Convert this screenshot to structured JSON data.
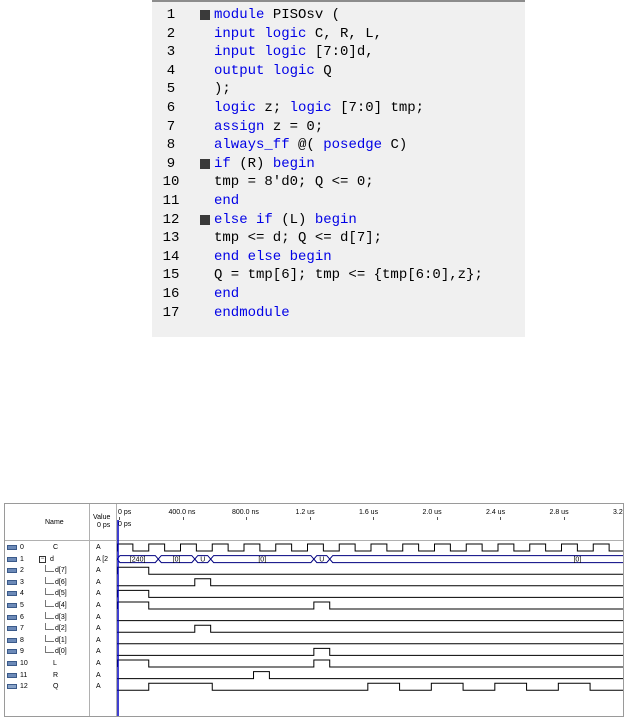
{
  "editor": {
    "lines": [
      {
        "num": "1",
        "fold": true,
        "parts": [
          {
            "t": "module ",
            "kw": true
          },
          {
            "t": "PISOsv (",
            "kw": false
          }
        ]
      },
      {
        "num": "2",
        "fold": false,
        "parts": [
          {
            "t": "input logic ",
            "kw": true
          },
          {
            "t": "C, R, L,",
            "kw": false
          }
        ]
      },
      {
        "num": "3",
        "fold": false,
        "parts": [
          {
            "t": "input logic ",
            "kw": true
          },
          {
            "t": "[7:0]d,",
            "kw": false
          }
        ]
      },
      {
        "num": "4",
        "fold": false,
        "parts": [
          {
            "t": "output logic ",
            "kw": true
          },
          {
            "t": "Q",
            "kw": false
          }
        ]
      },
      {
        "num": "5",
        "fold": false,
        "parts": [
          {
            "t": ");",
            "kw": false
          }
        ]
      },
      {
        "num": "6",
        "fold": false,
        "parts": [
          {
            "t": "logic ",
            "kw": true
          },
          {
            "t": "z; ",
            "kw": false
          },
          {
            "t": "logic ",
            "kw": true
          },
          {
            "t": "[7:0] tmp;",
            "kw": false
          }
        ]
      },
      {
        "num": "7",
        "fold": false,
        "parts": [
          {
            "t": "assign ",
            "kw": true
          },
          {
            "t": "z = 0;",
            "kw": false
          }
        ]
      },
      {
        "num": "8",
        "fold": false,
        "parts": [
          {
            "t": "always_ff ",
            "kw": true
          },
          {
            "t": "@( ",
            "kw": false
          },
          {
            "t": "posedge ",
            "kw": true
          },
          {
            "t": "C)",
            "kw": false
          }
        ]
      },
      {
        "num": "9",
        "fold": true,
        "parts": [
          {
            "t": "if ",
            "kw": true
          },
          {
            "t": "(R) ",
            "kw": false
          },
          {
            "t": "begin",
            "kw": true
          }
        ]
      },
      {
        "num": "10",
        "fold": false,
        "parts": [
          {
            "t": "tmp = 8'd0; Q <= 0;",
            "kw": false
          }
        ]
      },
      {
        "num": "11",
        "fold": false,
        "parts": [
          {
            "t": "end",
            "kw": true
          }
        ]
      },
      {
        "num": "12",
        "fold": true,
        "parts": [
          {
            "t": "else if ",
            "kw": true
          },
          {
            "t": "(L) ",
            "kw": false
          },
          {
            "t": "begin",
            "kw": true
          }
        ]
      },
      {
        "num": "13",
        "fold": false,
        "parts": [
          {
            "t": "tmp <= d; Q <= d[7];",
            "kw": false
          }
        ]
      },
      {
        "num": "14",
        "fold": false,
        "parts": [
          {
            "t": "end else begin",
            "kw": true
          }
        ]
      },
      {
        "num": "15",
        "fold": false,
        "parts": [
          {
            "t": "Q = tmp[6]; tmp <= {tmp[6:0],z};",
            "kw": false
          }
        ]
      },
      {
        "num": "16",
        "fold": false,
        "parts": [
          {
            "t": "end",
            "kw": true
          }
        ]
      },
      {
        "num": "17",
        "fold": false,
        "parts": [
          {
            "t": "endmodule",
            "kw": true
          }
        ]
      }
    ]
  },
  "waveform": {
    "header_name": "Name",
    "header_value": "Value\n0 ps",
    "cursor_label": "0 ps",
    "timeline": [
      "0 ps",
      "400.0 ns",
      "800.0 ns",
      "1.2 us",
      "1.6 us",
      "2.0 us",
      "2.4 us",
      "2.8 us",
      "3.2 us"
    ],
    "signals": [
      {
        "idx": "0",
        "name": "C",
        "value": "A",
        "indent": 0,
        "kind": "in"
      },
      {
        "idx": "1",
        "name": "d",
        "value": "A [2",
        "indent": 0,
        "kind": "in",
        "expandable": true
      },
      {
        "idx": "2",
        "name": "d[7]",
        "value": "A",
        "indent": 1,
        "kind": "in"
      },
      {
        "idx": "3",
        "name": "d[6]",
        "value": "A",
        "indent": 1,
        "kind": "in"
      },
      {
        "idx": "4",
        "name": "d[5]",
        "value": "A",
        "indent": 1,
        "kind": "in"
      },
      {
        "idx": "5",
        "name": "d[4]",
        "value": "A",
        "indent": 1,
        "kind": "in"
      },
      {
        "idx": "6",
        "name": "d[3]",
        "value": "A",
        "indent": 1,
        "kind": "in"
      },
      {
        "idx": "7",
        "name": "d[2]",
        "value": "A",
        "indent": 1,
        "kind": "in"
      },
      {
        "idx": "8",
        "name": "d[1]",
        "value": "A",
        "indent": 1,
        "kind": "in"
      },
      {
        "idx": "9",
        "name": "d[0]",
        "value": "A",
        "indent": 1,
        "kind": "in"
      },
      {
        "idx": "10",
        "name": "L",
        "value": "A",
        "indent": 0,
        "kind": "in"
      },
      {
        "idx": "11",
        "name": "R",
        "value": "A",
        "indent": 0,
        "kind": "in"
      },
      {
        "idx": "12",
        "name": "Q",
        "value": "A",
        "indent": 0,
        "kind": "out"
      }
    ],
    "bus_labels": [
      "[240]",
      "[0]",
      "U",
      "[0]",
      "U",
      "[0]"
    ],
    "colors": {
      "wave": "#000000",
      "bus": "#000080",
      "pin": "#6c8ab8"
    }
  }
}
